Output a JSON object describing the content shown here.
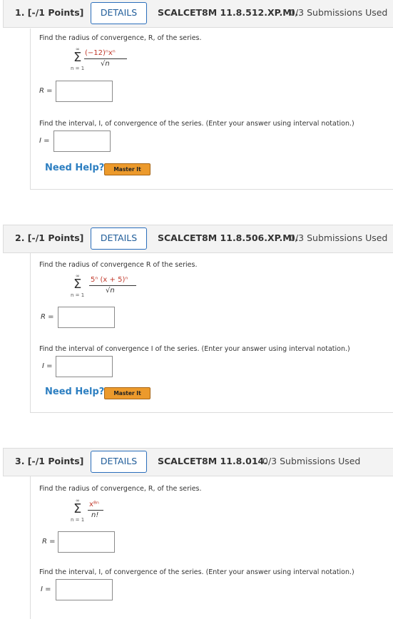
{
  "questions": [
    {
      "title": "1. [-/1 Points]",
      "details_label": "DETAILS",
      "code": "SCALCET8M 11.8.512.XP.MI.",
      "submissions": "0/3 Submissions Used",
      "prompt_radius": "Find the radius of convergence, R, of the series.",
      "sum_upper": "∞",
      "sum_lower": "n = 1",
      "numerator": "(−12)ⁿxⁿ",
      "denominator": "√n",
      "radius_label": "R =",
      "radius_value": "",
      "prompt_interval": "Find the interval, I, of convergence of the series. (Enter your answer using interval notation.)",
      "interval_label": "I =",
      "interval_value": "",
      "need_help": "Need Help?",
      "master_it": "Master It"
    },
    {
      "title": "2. [-/1 Points]",
      "details_label": "DETAILS",
      "code": "SCALCET8M 11.8.506.XP.MI.",
      "submissions": "0/3 Submissions Used",
      "prompt_radius": "Find the radius of convergence R of the series.",
      "sum_upper": "∞",
      "sum_lower": "n = 1",
      "numerator": "5ⁿ (x + 5)ⁿ",
      "denominator": "√n",
      "radius_label": "R =",
      "radius_value": "",
      "prompt_interval": "Find the interval of convergence I of the series. (Enter your answer using interval notation.)",
      "interval_label": "I =",
      "interval_value": "",
      "need_help": "Need Help?",
      "master_it": "Master It"
    },
    {
      "title": "3. [-/1 Points]",
      "details_label": "DETAILS",
      "code": "SCALCET8M 11.8.014.",
      "submissions": "0/3 Submissions Used",
      "prompt_radius": "Find the radius of convergence, R, of the series.",
      "sum_upper": "∞",
      "sum_lower": "n = 1",
      "numerator": "x⁸ⁿ",
      "denominator": "n!",
      "radius_label": "R =",
      "radius_value": "",
      "prompt_interval": "Find the interval, I, of convergence of the series. (Enter your answer using interval notation.)",
      "interval_label": "I =",
      "interval_value": ""
    }
  ],
  "colors": {
    "header_bg": "#f3f3f3",
    "details_border": "#2a6ebb",
    "need_help": "#2d7fc1",
    "master_it_bg": "#ec9a2c",
    "numerator_highlight": "#c0392b"
  },
  "icons": {
    "sum": "summation-sigma"
  }
}
